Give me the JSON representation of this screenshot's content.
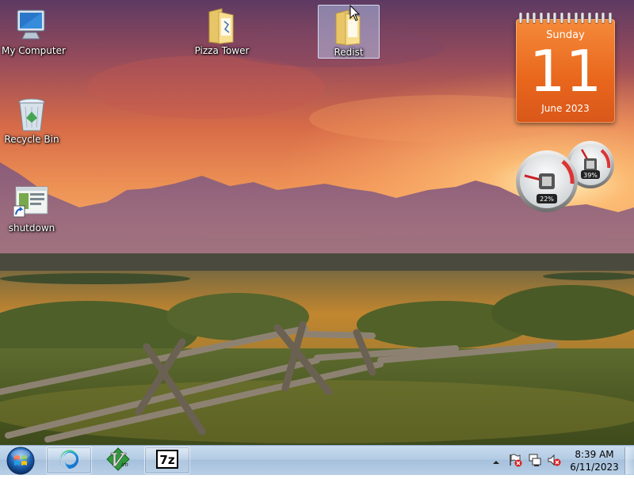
{
  "desktop": {
    "icons": [
      {
        "label": "My Computer",
        "icon": "computer-icon"
      },
      {
        "label": "Recycle Bin",
        "icon": "recycle-bin-icon"
      },
      {
        "label": "shutdown",
        "icon": "shortcut-icon"
      },
      {
        "label": "Pizza Tower",
        "icon": "folder-icon"
      },
      {
        "label": "Redist",
        "icon": "folder-icon",
        "selected": true
      }
    ]
  },
  "gadgets": {
    "calendar": {
      "weekday": "Sunday",
      "day": "11",
      "month_year": "June 2023"
    },
    "cpu_meter": {
      "cpu": "22%",
      "memory": "39%",
      "cpu_fraction": 0.22,
      "memory_fraction": 0.39
    }
  },
  "taskbar": {
    "start_icon": "windows-start-orb",
    "pinned": [
      {
        "name": "edge-icon",
        "active": true
      },
      {
        "name": "vim-icon",
        "active": false
      },
      {
        "name": "7zip-icon",
        "active": true
      }
    ],
    "tray": {
      "overflow_icon": "chevron-up-icon",
      "icons": [
        "action-center-flag-icon",
        "network-icon",
        "volume-muted-icon"
      ],
      "time": "8:39 AM",
      "date": "6/11/2023"
    }
  },
  "colors": {
    "accent": "#e8661c",
    "taskbar": "#b3cbe3",
    "sky_top": "#6d3e6a",
    "sky_mid": "#e37a4b",
    "field": "#c88a2e"
  }
}
